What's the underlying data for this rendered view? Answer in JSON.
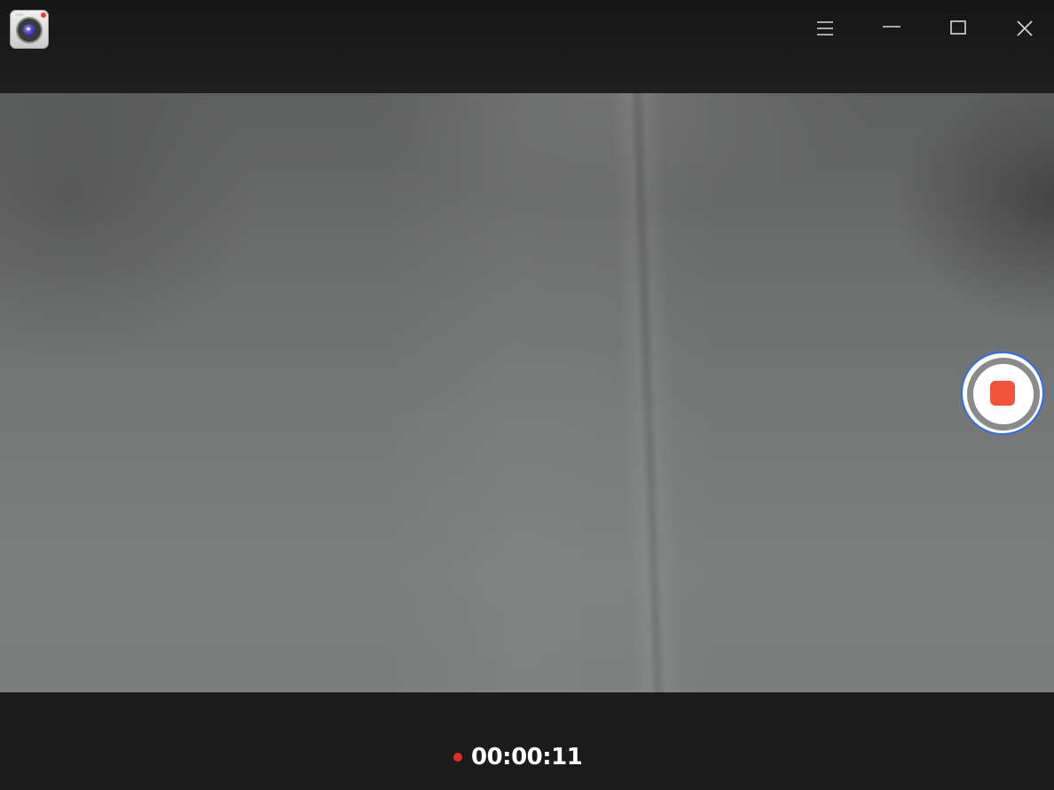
{
  "app": {
    "icon": "camera-app-icon"
  },
  "window_controls": {
    "menu_icon": "hamburger-menu-icon",
    "minimize_icon": "minimize-icon",
    "maximize_icon": "maximize-icon",
    "close_icon": "close-icon"
  },
  "viewfinder": {
    "record_button_icon": "stop-recording-icon"
  },
  "recording": {
    "indicator_icon": "recording-dot-icon",
    "elapsed_time": "00:00:11"
  },
  "colors": {
    "titlebar_background": "#1b1b1b",
    "record_ring_accent": "#2a6cf0",
    "stop_square": "#f2543a",
    "recording_dot": "#e02a25",
    "timer_text": "#ffffff"
  }
}
